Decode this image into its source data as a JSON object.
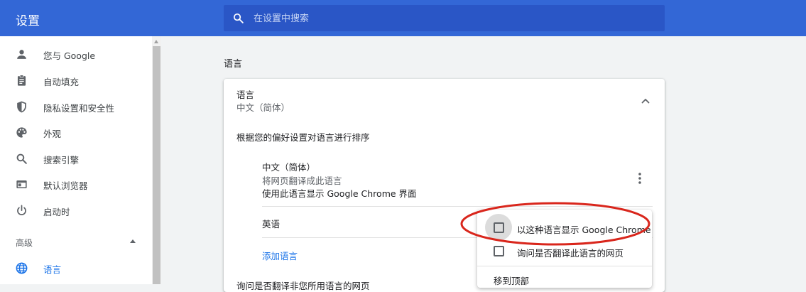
{
  "header": {
    "title": "设置",
    "search_placeholder": "在设置中搜索"
  },
  "sidebar": {
    "items": [
      {
        "label": "您与 Google",
        "icon": "person-icon"
      },
      {
        "label": "自动填充",
        "icon": "clipboard-icon"
      },
      {
        "label": "隐私设置和安全性",
        "icon": "shield-icon"
      },
      {
        "label": "外观",
        "icon": "palette-icon"
      },
      {
        "label": "搜索引擎",
        "icon": "search-icon"
      },
      {
        "label": "默认浏览器",
        "icon": "browser-icon"
      },
      {
        "label": "启动时",
        "icon": "power-icon"
      }
    ],
    "advanced_label": "高级",
    "active_item": {
      "label": "语言",
      "icon": "globe-icon"
    }
  },
  "main": {
    "section_title": "语言",
    "card": {
      "language_label": "语言",
      "language_value": "中文（简体）",
      "sort_hint": "根据您的偏好设置对语言进行排序",
      "languages": [
        {
          "name": "中文（简体）",
          "line1": "将网页翻译成此语言",
          "line2": "使用此语言显示 Google Chrome 界面"
        },
        {
          "name": "英语"
        }
      ],
      "add_language": "添加语言",
      "bottom_text": "询问是否翻译非您所用语言的网页"
    }
  },
  "context_menu": {
    "items": [
      {
        "label": "以这种语言显示 Google Chrome",
        "checked": false
      },
      {
        "label": "询问是否翻译此语言的网页",
        "checked": false
      }
    ],
    "move_to_top": "移到顶部"
  },
  "colors": {
    "header_bg": "#3367d6",
    "search_bg": "#2a56c6",
    "accent": "#1a73e8",
    "highlight_ellipse": "#d9261c"
  }
}
